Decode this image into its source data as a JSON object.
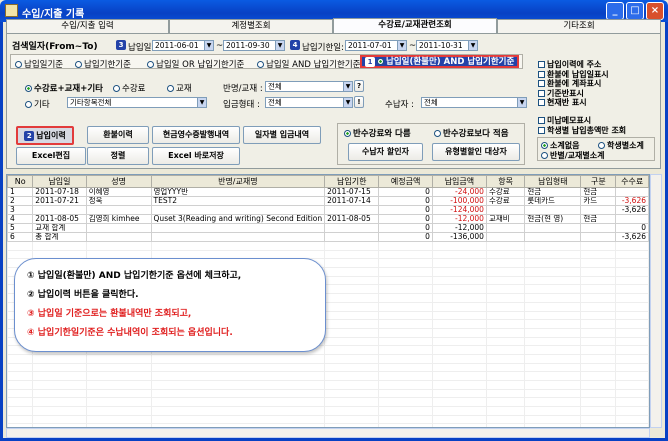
{
  "window": {
    "title": "수입/지출 기록"
  },
  "tabs": [
    "수입/지출 입력",
    "계정별조회",
    "수강료/교재관련조회",
    "기타조회"
  ],
  "search": {
    "period_label": "검색일자(From~To)",
    "badge3": "3",
    "pay_date_label": "납입일 :",
    "pay_from": "2011-06-01",
    "tilde1": "~",
    "pay_to": "2011-09-30",
    "badge4": "4",
    "due_date_label": "납입기한일:",
    "due_from": "2011-07-01",
    "tilde2": "~",
    "due_to": "2011-10-31"
  },
  "date_options": [
    "납입일기준",
    "납입기한기준",
    "납입일 OR 납입기한기준",
    "납입일 AND 납입기한기준"
  ],
  "date_option_selected_badge": "1",
  "date_option_selected": "납입일(환불만) AND 납입기한기준",
  "filters": {
    "kind_options": [
      "수강료+교재+기타",
      "수강료",
      "교재"
    ],
    "kind_other": "기타",
    "kind_other_value": "기타항목전체",
    "class_label": "반명/교재 :",
    "class_value": "전체",
    "pay_type_label": "입금형태 :",
    "pay_type_value": "전체",
    "receiver_label": "수납자 :",
    "receiver_value": "전체",
    "q_btn": "?",
    "ex_btn": "!"
  },
  "right_checks": [
    "납입이력에 주소",
    "환불에 납입일표시",
    "환불에 계좌표시",
    "기준반표시",
    "현재반 표시"
  ],
  "right_checks2": [
    "미납메모표시",
    "학생별 납입총액만 조회"
  ],
  "subtotal_opts": [
    "소계없음",
    "학생별소계",
    "반별/교재별소계"
  ],
  "buttons": {
    "badge2": "2",
    "history": "납입이력",
    "refund": "환불이력",
    "cash_receipt": "현금영수증발행내역",
    "daily": "일자별 입금내역",
    "excel": "Excel편집",
    "sort": "정렬",
    "excel_save": "Excel 바로저장",
    "class_same": "반수강료와 다름",
    "class_less": "반수강료보다 적음",
    "receiver_view": "수납자 할인자",
    "type_target": "유형별할인 대상자"
  },
  "table": {
    "headers": [
      "No",
      "납입일",
      "성명",
      "반명/교재명",
      "납입기한",
      "예정금액",
      "납입금액",
      "항목",
      "납입형태",
      "구분",
      "수수료"
    ],
    "rows": [
      [
        "1",
        "2011-07-18",
        "이혜영",
        "영업YYY반",
        "2011-07-15",
        "0",
        "-24,000",
        "수강료",
        "현금",
        "현금",
        ""
      ],
      [
        "2",
        "2011-07-21",
        "정욱",
        "TEST2",
        "2011-07-14",
        "0",
        "-100,000",
        "수강료",
        "롯데카드",
        "카드",
        "-3,626"
      ],
      [
        "3",
        "",
        "",
        "",
        "",
        "0",
        "-124,000",
        "",
        "",
        "",
        "-3,626"
      ],
      [
        "4",
        "2011-08-05",
        "김영희 kimhee",
        "Quset 3(Reading and writing) Second Edition",
        "2011-08-05",
        "0",
        "-12,000",
        "교재비",
        "현금(현 영)",
        "현금",
        ""
      ],
      [
        "5",
        "교재 합계",
        "",
        "",
        "",
        "0",
        "-12,000",
        "",
        "",
        "",
        "0"
      ],
      [
        "6",
        "총 합계",
        "",
        "",
        "",
        "0",
        "-136,000",
        "",
        "",
        "",
        "-3,626"
      ]
    ]
  },
  "callout": [
    "① 납입일(환불만) AND 납입기한기준 옵션에 체크하고,",
    "② 납입이력 버튼을 클릭한다.",
    "③ 납입일 기준으로는  환불내역만 조회되고,",
    "④ 납입기한일기준은 수납내역이  조회되는 옵션입니다."
  ],
  "colors": {
    "accent": "#0841C4",
    "highlight": "#E23B3B",
    "negative": "#D01010"
  }
}
